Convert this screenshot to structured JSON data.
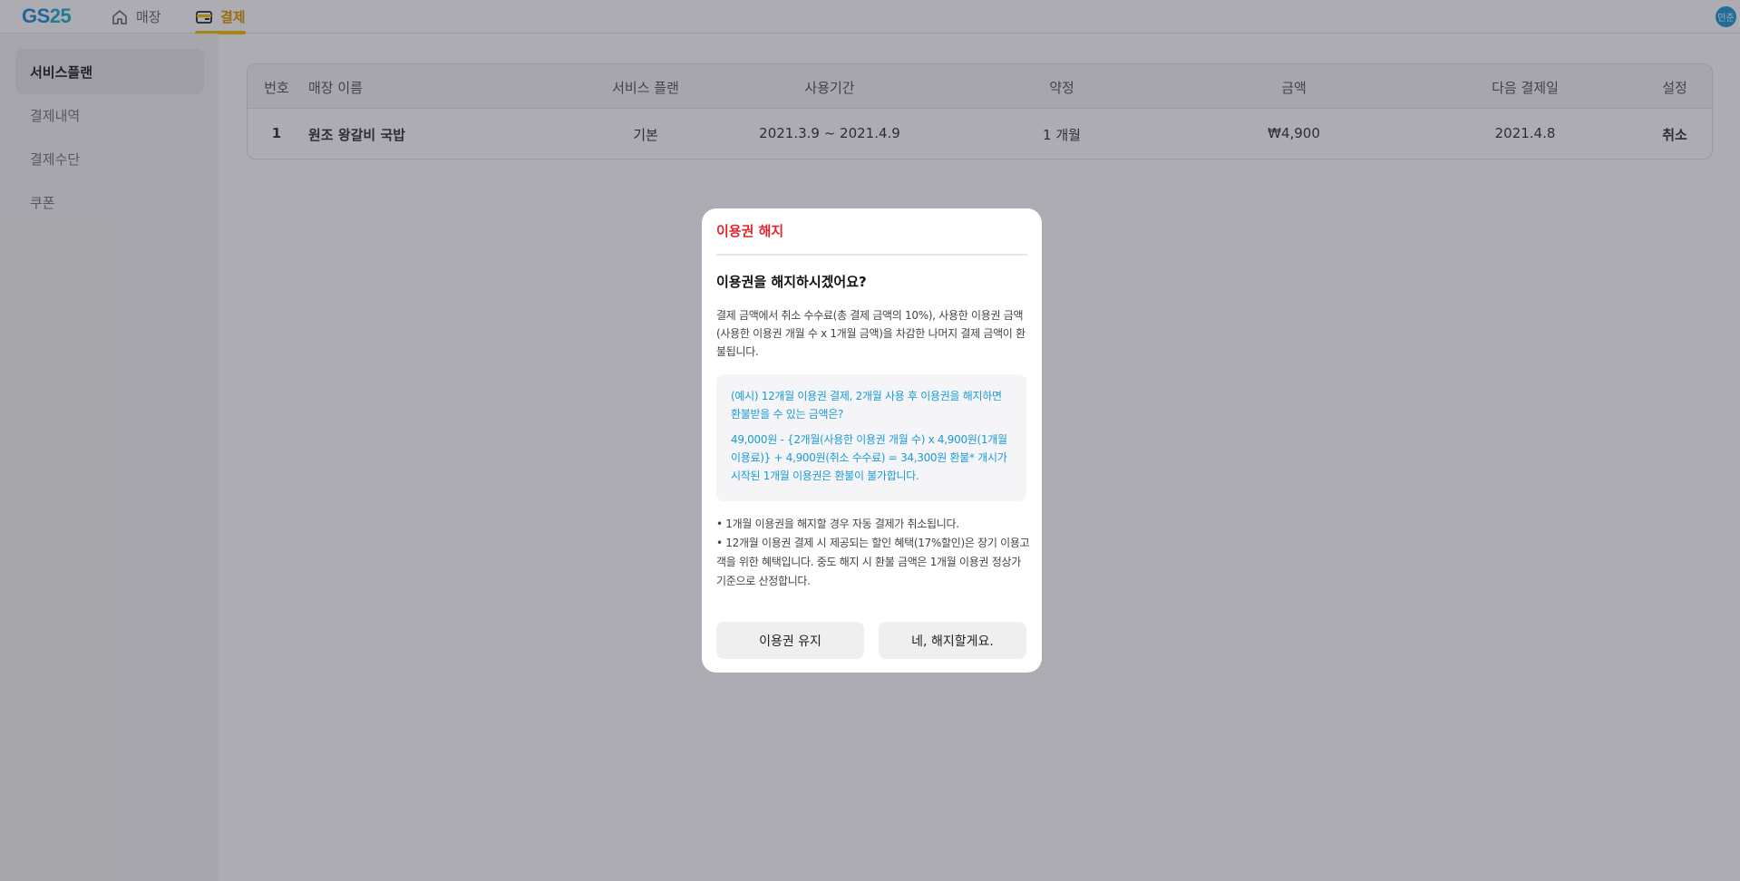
{
  "header": {
    "logo_gs": "GS",
    "logo_25": "25",
    "nav": [
      {
        "label": "매장",
        "icon": "home-icon",
        "active": false
      },
      {
        "label": "결제",
        "icon": "wallet-icon",
        "active": true
      }
    ],
    "avatar_text": "민준"
  },
  "sidebar": {
    "items": [
      {
        "label": "서비스플랜",
        "active": true
      },
      {
        "label": "결제내역",
        "active": false
      },
      {
        "label": "결제수단",
        "active": false
      },
      {
        "label": "쿠폰",
        "active": false
      }
    ]
  },
  "table": {
    "headers": {
      "no": "번호",
      "store": "매장 이름",
      "plan": "서비스 플랜",
      "period": "사용기간",
      "contract": "약정",
      "amount": "금액",
      "next_date": "다음 결제일",
      "settings": "설정"
    },
    "rows": [
      {
        "no": "1",
        "store": "원조 왕갈비 국밥",
        "plan": "기본",
        "period": "2021.3.9 ~ 2021.4.9",
        "contract": "1 개월",
        "amount": "₩4,900",
        "next_date": "2021.4.8",
        "action": "취소"
      }
    ]
  },
  "modal": {
    "title": "이용권 해지",
    "question": "이용권을 해지하시겠어요?",
    "description": "결제 금액에서 취소 수수료(총 결제 금액의 10%), 사용한 이용권 금액(사용한 이용권 개월 수 x 1개월 금액)을 차감한 나머지 결제 금액이 환불됩니다.",
    "example_question": "(예시) 12개월 이용권 결제, 2개월 사용 후 이용권을 해지하면 환불받을 수 있는 금액은?",
    "example_answer": "49,000원 - {2개월(사용한 이용권 개월 수) x 4,900원(1개월 이용료)} + 4,900원(취소 수수료) = 34,300원 환불* 개시가 시작된 1개월 이용권은 환불이 불가합니다.",
    "notes": [
      "• 1개월 이용권을 해지할 경우 자동 결제가 취소됩니다.",
      "• 12개월 이용권 결제 시 제공되는 할인 혜택(17%할인)은 장기 이용고객을 위한 혜택입니다. 중도 해지 시 환불 금액은 1개월 이용권 정상가 기준으로 산정합니다."
    ],
    "keep_label": "이용권 유지",
    "confirm_label": "네, 해지할게요."
  },
  "colors": {
    "accent_yellow": "#f2c200",
    "danger": "#e0262e",
    "info_blue": "#1a9bd6"
  }
}
